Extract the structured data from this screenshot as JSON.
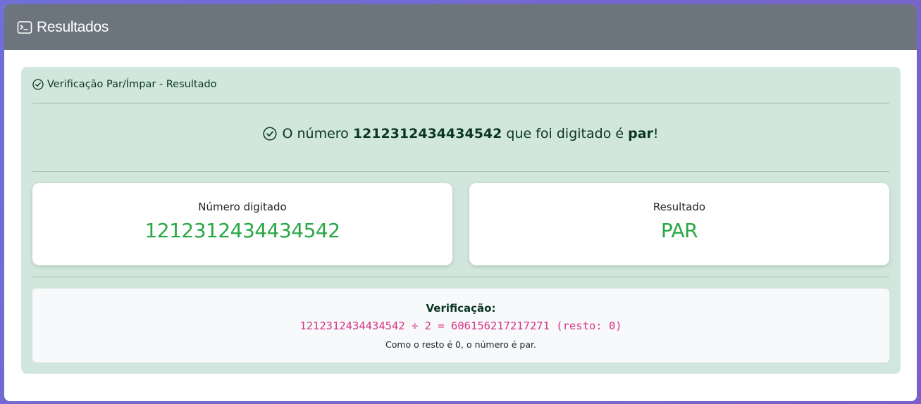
{
  "header": {
    "title": "Resultados",
    "icon": "terminal-icon"
  },
  "alert": {
    "heading": "Verificação Par/Ímpar - Resultado",
    "heading_icon": "check-circle-icon",
    "message": {
      "prefix": "O número ",
      "number": "1212312434434542",
      "middle": " que foi digitado é ",
      "result": "par",
      "suffix": "!"
    }
  },
  "stats": {
    "number_label": "Número digitado",
    "number_value": "1212312434434542",
    "result_label": "Resultado",
    "result_value": "PAR"
  },
  "verification": {
    "title": "Verificação:",
    "code": "1212312434434542 ÷ 2 = 606156217217271 (resto: 0)",
    "note": "Como o resto é 0, o número é par."
  },
  "colors": {
    "header_bg": "#6c757d",
    "alert_bg": "#d1e7dd",
    "value_green": "#28a745",
    "code_pink": "#d63384"
  }
}
